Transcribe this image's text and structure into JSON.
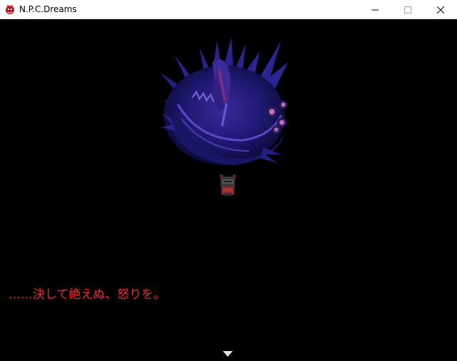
{
  "window": {
    "title": "N.P.C.Dreams",
    "icon": "app-icon",
    "controls": [
      "minimize-icon",
      "maximize-icon",
      "close-icon"
    ]
  },
  "game": {
    "background": "#000000",
    "message": {
      "text": "……決して絶えぬ、怒りを。",
      "color": "#f12a2a"
    },
    "sprites": [
      "dragon-boss-sprite",
      "player-character-sprite"
    ],
    "indicator": "advance-arrow-icon"
  }
}
